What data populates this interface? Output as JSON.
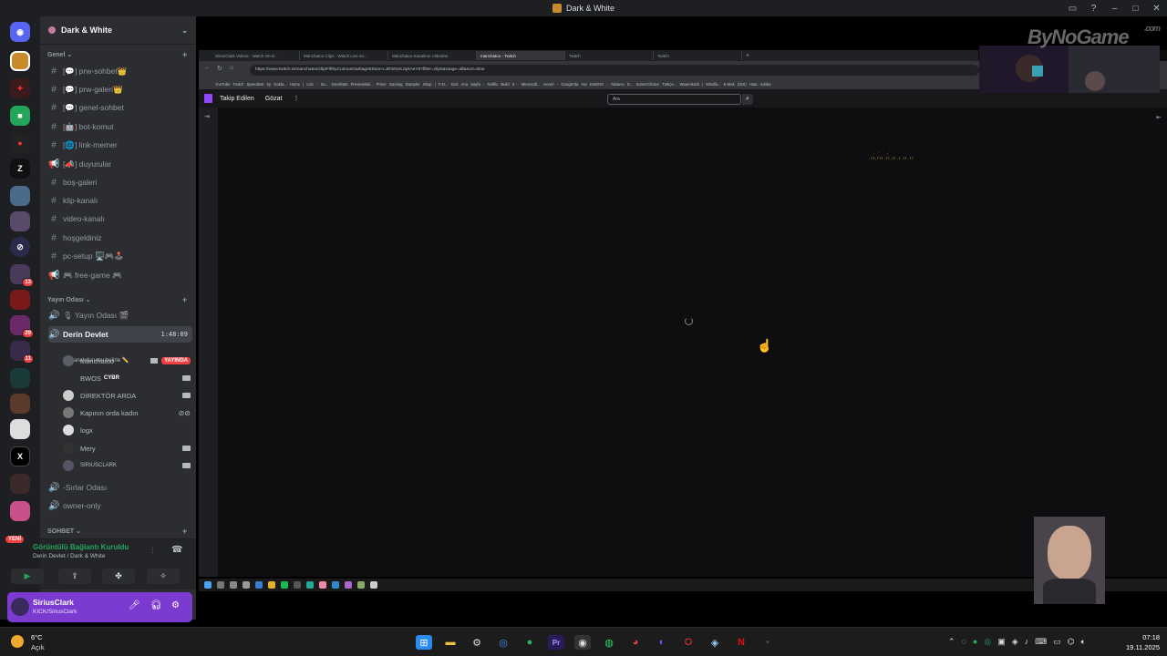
{
  "window": {
    "title": "Dark & White"
  },
  "server": {
    "name": "Dark & White"
  },
  "categories": {
    "genel": "Genel",
    "yayin": "Yayın Odası",
    "sohbet": "SOHBET"
  },
  "channels": [
    {
      "label": "[💬] prw-sohbet👑"
    },
    {
      "label": "[💬] prw-galeri👑"
    },
    {
      "label": "[💬] genel-sohbet"
    },
    {
      "label": "[🤖] bot-komut"
    },
    {
      "label": "[🌐] link-memer"
    },
    {
      "label": "[📣] duyurular"
    },
    {
      "label": "boş-galeri"
    },
    {
      "label": "klip-kanalı"
    },
    {
      "label": "video-kanalı"
    },
    {
      "label": "hoşgeldiniz"
    },
    {
      "label": "pc-setup 🖥️🎮🕹️"
    },
    {
      "label": "🎮 free-game 🎮"
    }
  ],
  "voice_channels": {
    "yayin_odasi": "🎙 Yayın Odası 🎬",
    "derin_devlet": "Derin Devlet",
    "derin_time": "1:48:09",
    "derin_status": "Bir kanal durumu belirle ✏️",
    "sirlar": "-Sırlar Odası",
    "owner": "owner-only"
  },
  "voice_users": [
    {
      "name": "Manchatoo",
      "live": "YAYINDA"
    },
    {
      "name": "BWOS",
      "tag": "CYBR"
    },
    {
      "name": "DİREKTÖR ARDA"
    },
    {
      "name": "Kapının orda kadın"
    },
    {
      "name": "logx"
    },
    {
      "name": "Mery"
    },
    {
      "name": "SIRIUSCLARK"
    }
  ],
  "voice_panel": {
    "title": "Görüntülü Bağlantı Kuruldu",
    "subtitle": "Derin Devlet / Dark & White"
  },
  "user_panel": {
    "name": "SiriusClark",
    "status": "KICK/SiriusClark"
  },
  "server_badges": {
    "a": "13",
    "b": "29",
    "c": "11",
    "new": "YENİ"
  },
  "browser": {
    "tabs": [
      "SiriusClark Videos - Watch On-D...",
      "Manchatoo Clips - Watch Live on...",
      "Manchatoo Kanalının Videoları",
      "manchatoo - Twitch",
      "Twitch",
      "Twitch"
    ],
    "url": "https://www.twitch.tv/manchatoo/clip/FilthyCuriousGarbage5Soon-LJEW3cKJqSAeY6?filter=clips&range=all&sort=time",
    "bookmarks": "YouTube  Twitch  Speedtest by Ookla...  Home |  Linc - Su...  Geoshats Previewsite...  Prime Gaming  Dampfer Shop | F-D...  Kick  Ana Sayfa - Netflix  Build It - Minecraft...  cevviri - Google'da Ara  DieBOX - Yabancı D...  SomerChoice Türkçe...  Waarmkorb | Mindfa...  E-Mail (GIS)  Hata  Adobe",
    "nav_following": "Takip Edilen",
    "nav_browse": "Gözat",
    "search_placeholder": "Ara"
  },
  "watermark": {
    "text": "ByNoGame",
    "suffix": ".com"
  },
  "taskbar": {
    "temp": "6°C",
    "weather": "Açık",
    "time": "07:18",
    "date": "19.11.2025"
  },
  "colors": {
    "accent": "#9147ff",
    "discord_bg": "#2b2d31",
    "user_panel": "#7b3bd1",
    "online": "#23a55a",
    "live": "#f23f43"
  }
}
